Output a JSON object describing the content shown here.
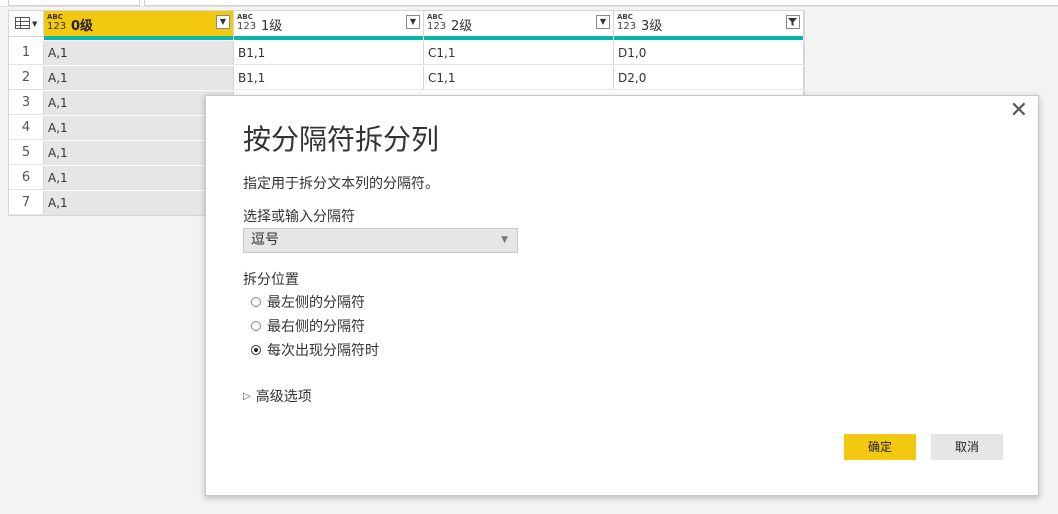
{
  "grid": {
    "columns": [
      {
        "type_top": "ABC",
        "type_bottom": "123",
        "name": "0级",
        "selected": true,
        "menu_icon": "chevron-down-icon"
      },
      {
        "type_top": "ABC",
        "type_bottom": "123",
        "name": "1级",
        "selected": false,
        "menu_icon": "chevron-down-icon"
      },
      {
        "type_top": "ABC",
        "type_bottom": "123",
        "name": "2级",
        "selected": false,
        "menu_icon": "chevron-down-icon"
      },
      {
        "type_top": "ABC",
        "type_bottom": "123",
        "name": "3级",
        "selected": false,
        "menu_icon": "filter-icon"
      }
    ],
    "rows": [
      {
        "num": "1",
        "cells": [
          "A,1",
          "B1,1",
          "C1,1",
          "D1,0"
        ]
      },
      {
        "num": "2",
        "cells": [
          "A,1",
          "B1,1",
          "C1,1",
          "D2,0"
        ]
      },
      {
        "num": "3",
        "cells": [
          "A,1"
        ]
      },
      {
        "num": "4",
        "cells": [
          "A,1"
        ]
      },
      {
        "num": "5",
        "cells": [
          "A,1"
        ]
      },
      {
        "num": "6",
        "cells": [
          "A,1"
        ]
      },
      {
        "num": "7",
        "cells": [
          "A,1"
        ]
      }
    ]
  },
  "dialog": {
    "close": "✕",
    "title": "按分隔符拆分列",
    "subtitle": "指定用于拆分文本列的分隔符。",
    "delimiter_label": "选择或输入分隔符",
    "delimiter_value": "逗号",
    "position_label": "拆分位置",
    "options": [
      {
        "label": "最左侧的分隔符",
        "checked": false
      },
      {
        "label": "最右侧的分隔符",
        "checked": false
      },
      {
        "label": "每次出现分隔符时",
        "checked": true
      }
    ],
    "advanced": "高级选项",
    "ok": "确定",
    "cancel": "取消"
  },
  "colors": {
    "accent_yellow": "#f2c811",
    "teal": "#01b8aa"
  }
}
